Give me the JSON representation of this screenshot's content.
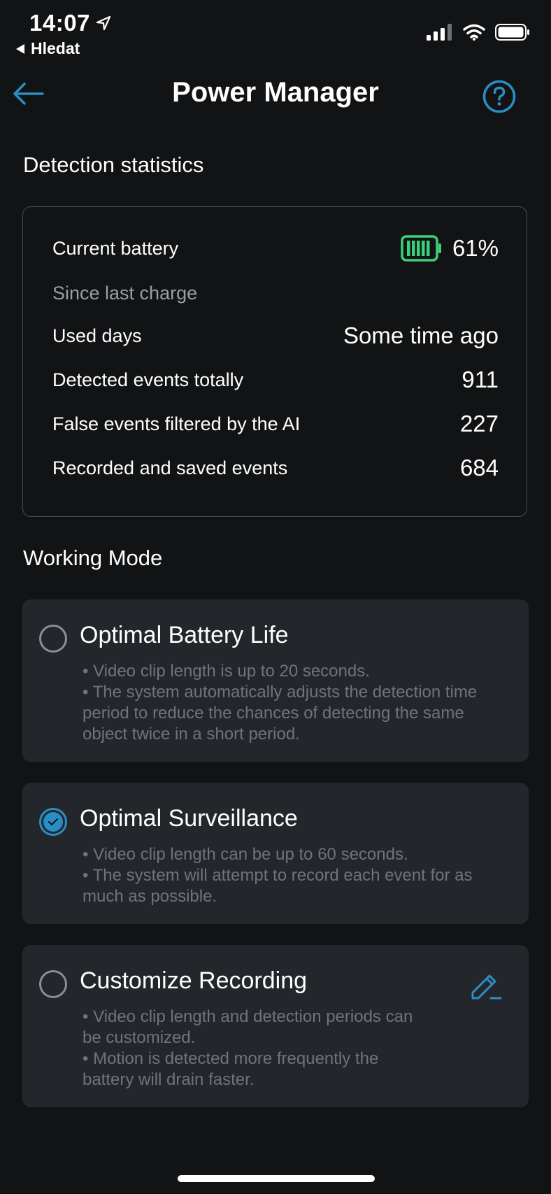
{
  "status_bar": {
    "time": "14:07",
    "back_app": "Hledat"
  },
  "nav": {
    "title": "Power Manager"
  },
  "stats": {
    "section_title": "Detection statistics",
    "current_battery_label": "Current battery",
    "battery_percent": "61%",
    "battery_level": 0.61,
    "battery_color": "#3dd07a",
    "since_last_charge": "Since last charge",
    "rows": [
      {
        "label": "Used days",
        "value": "Some time ago"
      },
      {
        "label": "Detected events totally",
        "value": "911"
      },
      {
        "label": "False events filtered by the AI",
        "value": "227"
      },
      {
        "label": "Recorded and saved events",
        "value": "684"
      }
    ]
  },
  "working_mode": {
    "section_title": "Working Mode",
    "modes": [
      {
        "title": "Optimal Battery Life",
        "selected": false,
        "lines": [
          "• Video clip length is up to 20 seconds.",
          "• The system automatically adjusts the detection time period to reduce the chances of detecting the same object twice in a short period."
        ]
      },
      {
        "title": "Optimal Surveillance",
        "selected": true,
        "lines": [
          "• Video clip length can be up to 60 seconds.",
          "• The system will attempt to record each event for as much as possible."
        ]
      },
      {
        "title": "Customize Recording",
        "selected": false,
        "editable": true,
        "lines": [
          "• Video clip length and detection periods can be customized.",
          "• Motion is detected more frequently the battery will drain faster."
        ]
      }
    ]
  },
  "colors": {
    "background": "#111315",
    "card": "#23272b",
    "accent": "#2a8ec6",
    "muted_text": "#6f7479"
  }
}
